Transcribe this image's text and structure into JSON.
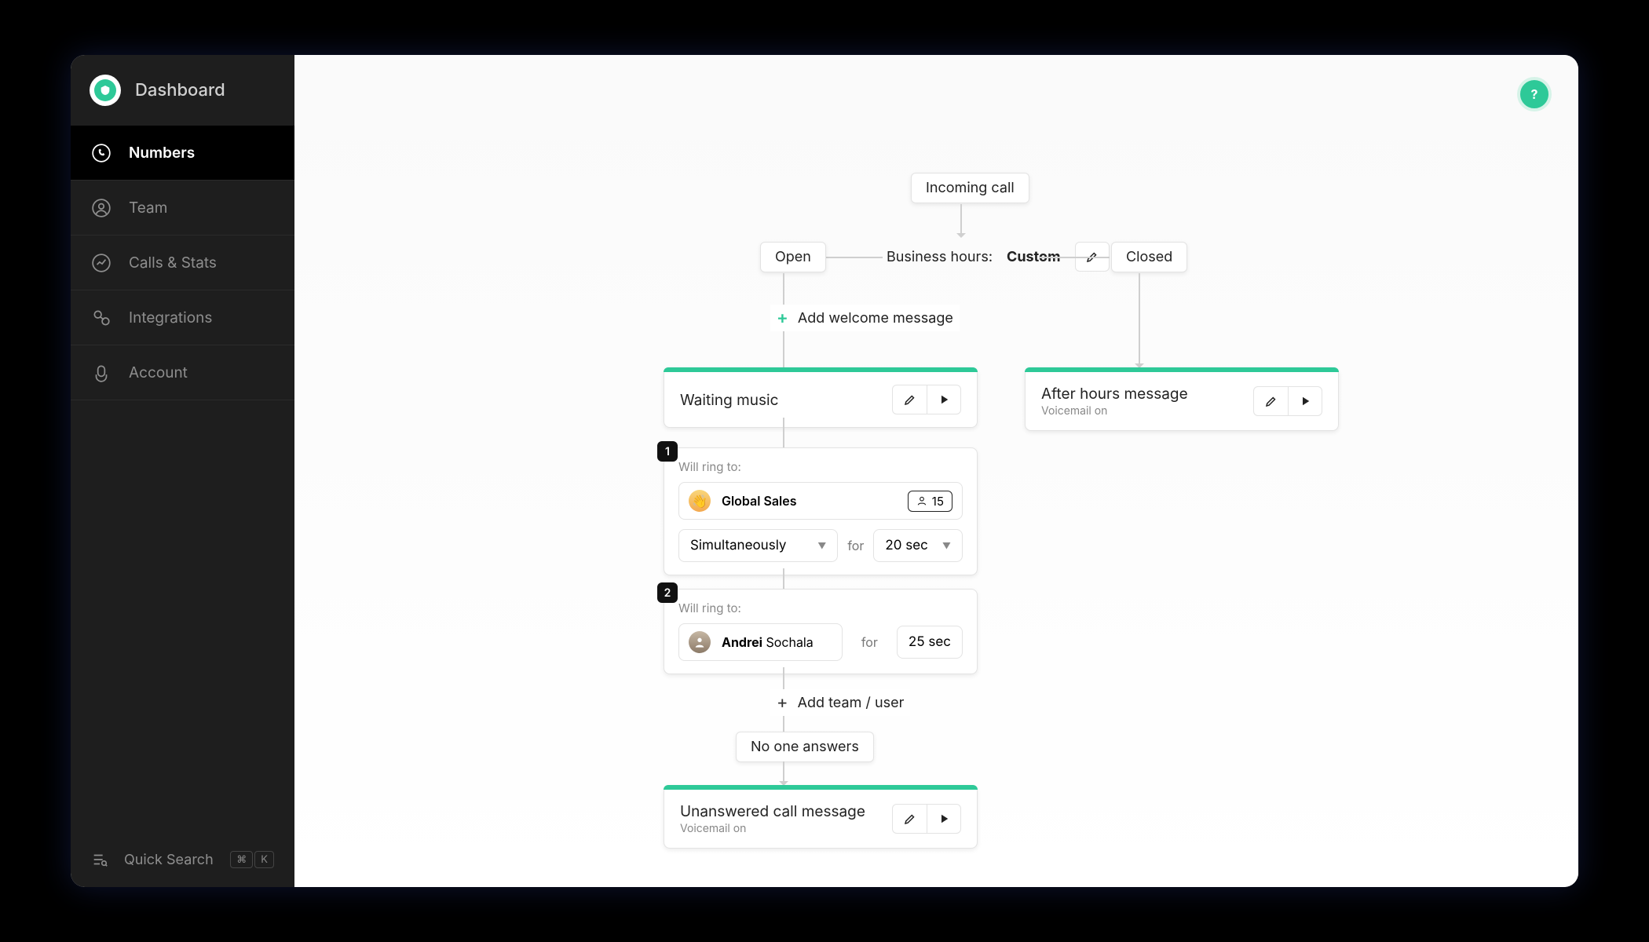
{
  "app": {
    "title": "Dashboard"
  },
  "sidebar": {
    "items": [
      {
        "id": "numbers",
        "label": "Numbers",
        "active": true
      },
      {
        "id": "team",
        "label": "Team",
        "active": false
      },
      {
        "id": "calls-stats",
        "label": "Calls & Stats",
        "active": false
      },
      {
        "id": "integrations",
        "label": "Integrations",
        "active": false
      },
      {
        "id": "account",
        "label": "Account",
        "active": false
      }
    ],
    "quick_search": {
      "label": "Quick Search",
      "kbd": [
        "⌘",
        "K"
      ]
    }
  },
  "help": {
    "glyph": "?"
  },
  "flow": {
    "incoming": "Incoming call",
    "open_label": "Open",
    "closed_label": "Closed",
    "business_hours": {
      "label": "Business hours:",
      "value": "Custom"
    },
    "add_welcome": "Add welcome message",
    "waiting_music": {
      "title": "Waiting music"
    },
    "ring_steps": [
      {
        "index": "1",
        "will_ring_label": "Will ring to:",
        "target_name_strong": "Global Sales",
        "target_name_rest": "",
        "member_count": "15",
        "mode": "Simultaneously",
        "for_label": "for",
        "duration": "20 sec",
        "kind": "team"
      },
      {
        "index": "2",
        "will_ring_label": "Will ring to:",
        "target_name_strong": "Andrei",
        "target_name_rest": " Sochala",
        "member_count": "",
        "mode": "",
        "for_label": "for",
        "duration": "25 sec",
        "kind": "person"
      }
    ],
    "add_team_user": "Add team / user",
    "no_answer": "No one answers",
    "unanswered": {
      "title": "Unanswered call message",
      "subtitle": "Voicemail on"
    },
    "after_hours": {
      "title": "After hours message",
      "subtitle": "Voicemail on"
    }
  }
}
